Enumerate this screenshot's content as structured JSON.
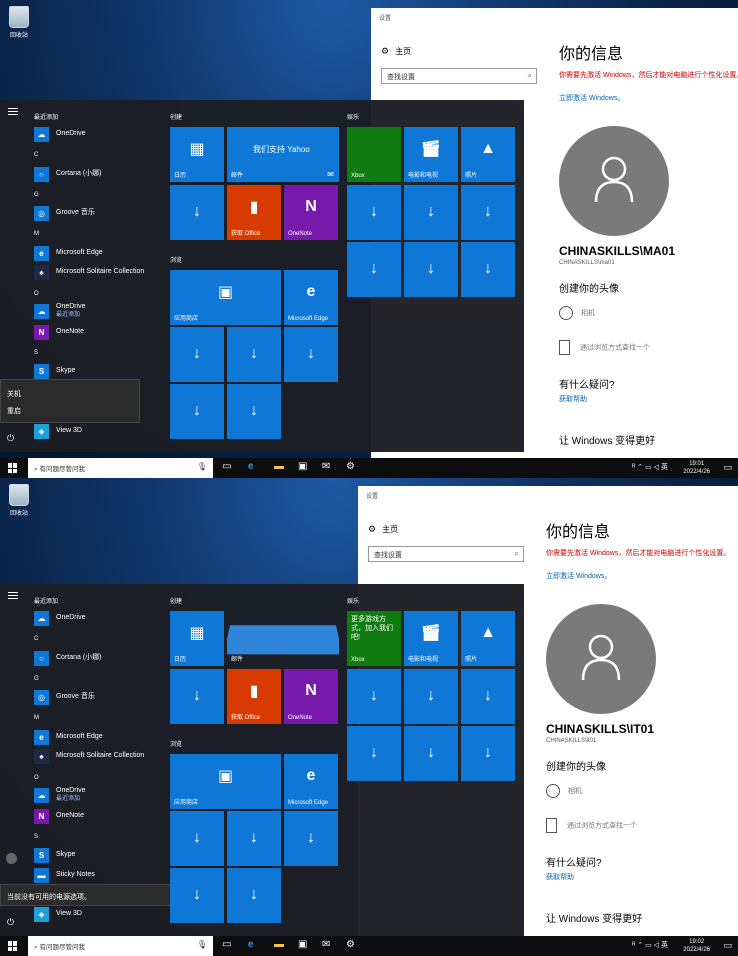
{
  "desktop": {
    "recycle_bin": "回收站"
  },
  "shots": [
    {
      "settings": {
        "window_title": "设置",
        "home": "主页",
        "search_placeholder": "查找设置",
        "heading": "你的信息",
        "warning": "你需要先激活 Windows，然后才能对电脑进行个性化设置。",
        "activate_link": "立即激活 Windows。",
        "account": "CHINASKILLS\\MA01",
        "account_sub": "CHINASKILLS\\ma01",
        "create_avatar": "创建你的头像",
        "camera": "相机",
        "browse": "通过浏览方式查找一个",
        "question": "有什么疑问?",
        "get_help": "获取帮助",
        "improve": "让 Windows 变得更好"
      },
      "start": {
        "recent": "最近添加",
        "apps": [
          "OneDrive",
          "Cortana (小娜)",
          "Groove 音乐",
          "Microsoft Edge",
          "Microsoft Solitaire Collection",
          "OneDrive",
          "OneNote",
          "Skype",
          "View 3D"
        ],
        "onedrive_sub": "最近添加",
        "letters": [
          "C",
          "G",
          "M",
          "O",
          "S"
        ],
        "power_popup": [
          "关机",
          "重启"
        ],
        "groups": [
          "创建",
          "浏览",
          "娱乐"
        ],
        "tiles": {
          "calendar": "日历",
          "yahoo": "我们支持 Yahoo",
          "mail": "邮件",
          "get_office": "获取 Office",
          "onenote": "OneNote",
          "store": "应用商店",
          "edge": "Microsoft Edge",
          "xbox": "Xbox",
          "movies": "电影和电视",
          "photos": "照片"
        }
      },
      "taskbar": {
        "search": "有问题尽管问我",
        "time": "19:01",
        "date": "2022/4/26",
        "ime": "英"
      }
    },
    {
      "settings": {
        "window_title": "设置",
        "home": "主页",
        "search_placeholder": "查找设置",
        "heading": "你的信息",
        "warning": "你需要先激活 Windows，然后才能对电脑进行个性化设置。",
        "activate_link": "立即激活 Windows。",
        "account": "CHINASKILLS\\IT01",
        "account_sub": "CHINASKILLS\\it01",
        "create_avatar": "创建你的头像",
        "camera": "相机",
        "browse": "通过浏览方式查找一个",
        "question": "有什么疑问?",
        "get_help": "获取帮助",
        "improve": "让 Windows 变得更好"
      },
      "start": {
        "recent": "最近添加",
        "apps": [
          "OneDrive",
          "Cortana (小娜)",
          "Groove 音乐",
          "Microsoft Edge",
          "Microsoft Solitaire Collection",
          "OneDrive",
          "OneNote",
          "Skype",
          "Sticky Notes",
          "View 3D"
        ],
        "onedrive_sub": "最近添加",
        "letters": [
          "C",
          "G",
          "M",
          "O",
          "S"
        ],
        "power_popup": [
          "当前没有可用的电源选项。"
        ],
        "groups": [
          "创建",
          "浏览",
          "娱乐"
        ],
        "tiles": {
          "calendar": "日历",
          "mail": "邮件",
          "get_office": "获取 Office",
          "onenote": "OneNote",
          "store": "应用商店",
          "edge": "Microsoft Edge",
          "xbox": "Xbox",
          "xbox_text": "更多游戏方式，加入我们吧!",
          "movies": "电影和电视",
          "photos": "照片"
        }
      },
      "taskbar": {
        "search": "有问题尽管问我",
        "time": "19:02",
        "date": "2022/4/26",
        "ime": "英"
      }
    }
  ]
}
